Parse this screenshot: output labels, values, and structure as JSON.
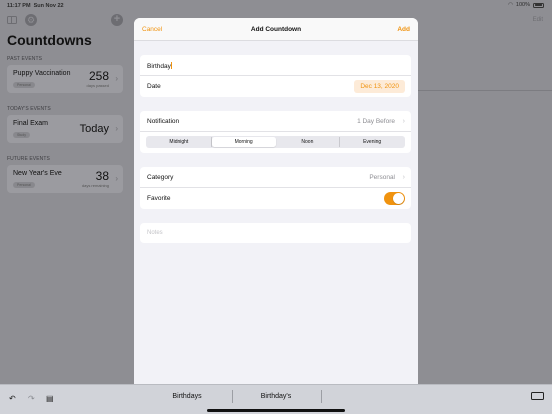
{
  "status": {
    "time": "11:17 PM",
    "date": "Sun Nov 22",
    "battery": "100%"
  },
  "sidebar": {
    "title": "Countdowns",
    "sections": [
      {
        "header": "PAST EVENTS",
        "event": {
          "name": "Puppy Vaccination",
          "tag": "Personal",
          "count": "258",
          "sub": "days passed"
        }
      },
      {
        "header": "TODAY'S EVENTS",
        "event": {
          "name": "Final Exam",
          "tag": "Study",
          "count": "Today",
          "sub": ""
        }
      },
      {
        "header": "FUTURE EVENTS",
        "event": {
          "name": "New Year's Eve",
          "tag": "Personal",
          "count": "38",
          "sub": "days remaining"
        }
      }
    ]
  },
  "detail": {
    "edit_label": "Edit"
  },
  "modal": {
    "cancel": "Cancel",
    "title": "Add Countdown",
    "add": "Add",
    "name_value": "Birthday",
    "date_label": "Date",
    "date_value": "Dec 13, 2020",
    "notification_label": "Notification",
    "notification_value": "1 Day Before",
    "segments": [
      "Midnight",
      "Morning",
      "Noon",
      "Evening"
    ],
    "selected_segment": "Morning",
    "category_label": "Category",
    "category_value": "Personal",
    "favorite_label": "Favorite",
    "favorite_on": true,
    "notes_placeholder": "Notes"
  },
  "keyboard": {
    "suggestions": [
      "Birthdays",
      "Birthday's"
    ]
  },
  "colors": {
    "accent": "#f0930f",
    "dim": "#8e8e93",
    "sheet": "#f2f2f7"
  }
}
